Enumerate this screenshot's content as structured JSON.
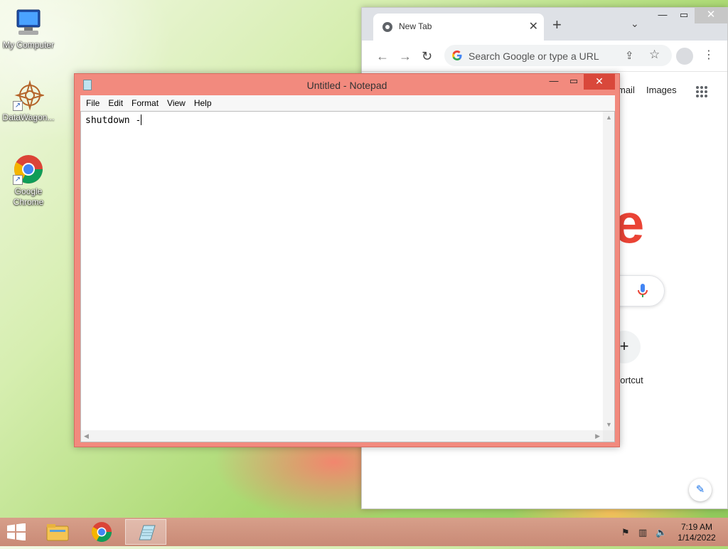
{
  "desktop": {
    "icons": [
      {
        "label": "My Computer",
        "icon": "computer-icon"
      },
      {
        "label": "DataWagon...",
        "icon": "datawagon-icon"
      },
      {
        "label": "Google\nChrome",
        "label_line1": "Google",
        "label_line2": "Chrome",
        "icon": "chrome-icon"
      }
    ]
  },
  "chrome": {
    "tab_title": "New Tab",
    "omnibox_placeholder": "Search Google or type a URL",
    "links": {
      "gmail": "mail",
      "images": "Images"
    },
    "logo_fragment": "e",
    "shortcut_label": "hortcut",
    "colors": {
      "logo_red": "#ea4335",
      "accent": "#1a73e8"
    }
  },
  "notepad": {
    "title": "Untitled - Notepad",
    "menu": [
      "File",
      "Edit",
      "Format",
      "View",
      "Help"
    ],
    "content": "shutdown -"
  },
  "taskbar": {
    "clock_time": "7:19 AM",
    "clock_date": "1/14/2022",
    "pinned": [
      "file-explorer-icon",
      "chrome-icon",
      "notepad-icon"
    ]
  }
}
